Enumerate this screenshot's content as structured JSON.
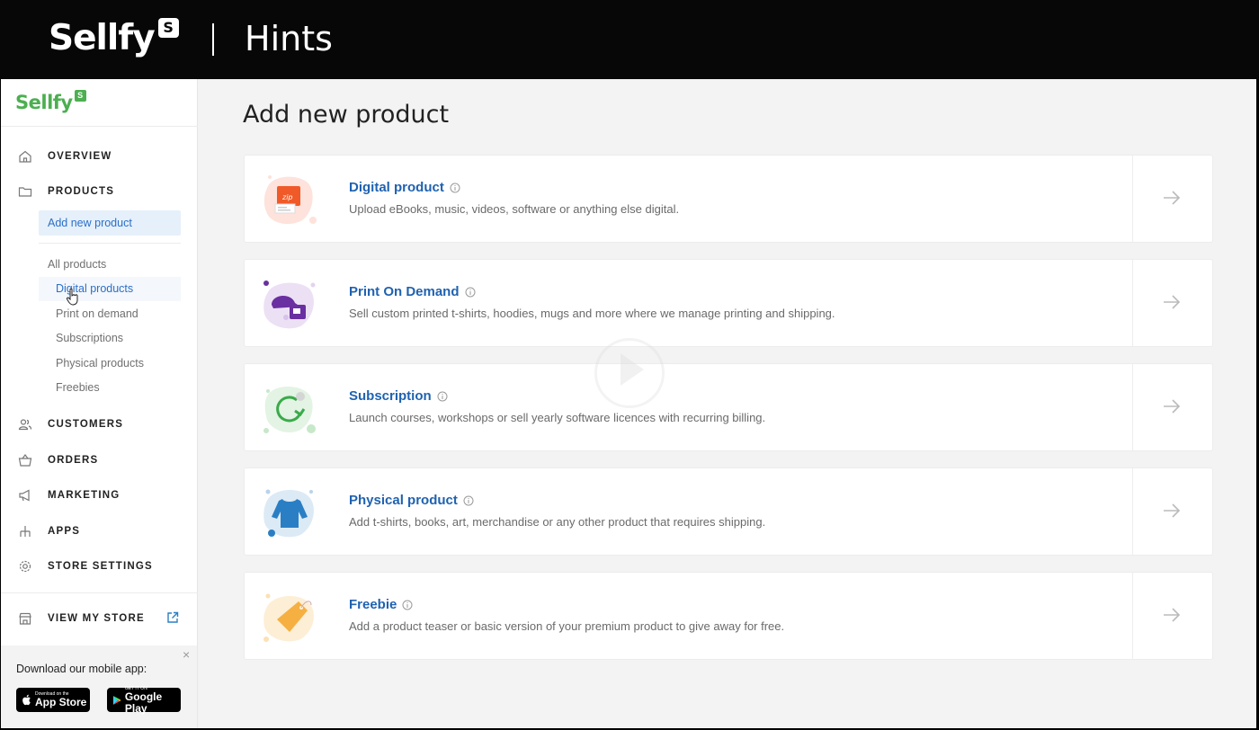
{
  "banner": {
    "logo_text": "Sellfy",
    "logo_badge": "S",
    "title": "Hints"
  },
  "sidebar": {
    "logo_text": "Sellfy",
    "logo_badge": "S",
    "nav": {
      "overview": "OVERVIEW",
      "products": "PRODUCTS",
      "customers": "CUSTOMERS",
      "orders": "ORDERS",
      "marketing": "MARKETING",
      "apps": "APPS",
      "store_settings": "STORE SETTINGS",
      "view_my_store": "VIEW MY STORE"
    },
    "products_sub": {
      "add_new": "Add new product",
      "all": "All products",
      "digital": "Digital products",
      "pod": "Print on demand",
      "subscriptions": "Subscriptions",
      "physical": "Physical products",
      "freebies": "Freebies"
    },
    "mobile": {
      "text": "Download our mobile app:",
      "close": "×",
      "app_store_small": "Download on the",
      "app_store": "App Store",
      "google_small": "GET IT ON",
      "google": "Google Play"
    }
  },
  "main": {
    "title": "Add new product",
    "cards": [
      {
        "title": "Digital product",
        "desc": "Upload eBooks, music, videos, software or anything else digital.",
        "icon": "zip-file-icon",
        "color": "#f05a28"
      },
      {
        "title": "Print On Demand",
        "desc": "Sell custom printed t-shirts, hoodies, mugs and more where we manage printing and shipping.",
        "icon": "cap-mug-icon",
        "color": "#6a2fa0"
      },
      {
        "title": "Subscription",
        "desc": "Launch courses, workshops or sell yearly software licences with recurring billing.",
        "icon": "recurring-icon",
        "color": "#3aaa4a"
      },
      {
        "title": "Physical product",
        "desc": "Add t-shirts, books, art, merchandise or any other product that requires shipping.",
        "icon": "sweater-icon",
        "color": "#2a7fc4"
      },
      {
        "title": "Freebie",
        "desc": "Add a product teaser or basic version of your premium product to give away for free.",
        "icon": "price-tag-icon",
        "color": "#f5b041"
      }
    ]
  },
  "colors": {
    "brand_green": "#4caf50",
    "link_blue": "#1f62b0",
    "active_bg": "#e6f0fa"
  }
}
